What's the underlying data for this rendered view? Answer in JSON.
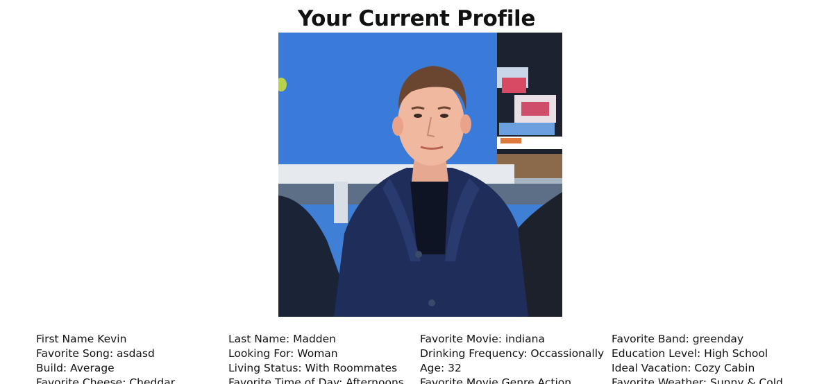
{
  "page": {
    "title": "Your Current Profile"
  },
  "profile_photo": {
    "description": "profile-photo"
  },
  "details": {
    "col1": [
      "First Name Kevin",
      "Favorite Song: asdasd",
      "Build: Average",
      "Favorite Cheese: Cheddar"
    ],
    "col2": [
      "Last Name: Madden",
      "Looking For: Woman",
      "Living Status: With Roommates",
      "Favorite Time of Day: Afternoons"
    ],
    "col3": [
      "Favorite Movie: indiana",
      "Drinking Frequency: Occassionally",
      "Age: 32",
      "Favorite Movie Genre Action"
    ],
    "col4": [
      "Favorite Band: greenday",
      "Education Level: High School",
      "Ideal Vacation: Cozy Cabin",
      "Favorite Weather: Sunny & Cold"
    ]
  }
}
